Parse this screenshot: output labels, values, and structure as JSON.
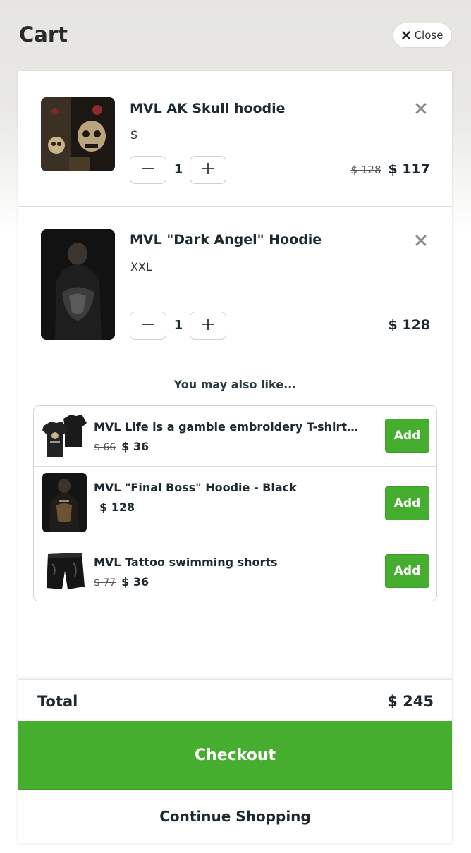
{
  "header": {
    "title": "Cart",
    "close_label": "Close",
    "close_icon": "close-icon"
  },
  "cart": {
    "items": [
      {
        "name": "MVL AK Skull hoodie",
        "variant": "S",
        "quantity": "1",
        "old_price": "$ 128",
        "price": "$ 117",
        "image_icon": "skull-hoodie-image"
      },
      {
        "name": "MVL \"Dark Angel\" Hoodie",
        "variant": "XXL",
        "quantity": "1",
        "old_price": "",
        "price": "$ 128",
        "image_icon": "dark-angel-hoodie-image"
      }
    ]
  },
  "upsell": {
    "title": "You may also like...",
    "add_label": "Add",
    "items": [
      {
        "name": "MVL Life is a gamble embroidery T-shirt - Black",
        "old_price": "$ 66",
        "price": "$ 36",
        "image_icon": "tshirt-image"
      },
      {
        "name": "MVL \"Final Boss\" Hoodie - Black",
        "old_price": "",
        "price": "$ 128",
        "image_icon": "final-boss-hoodie-image"
      },
      {
        "name": "MVL Tattoo swimming shorts",
        "old_price": "$ 77",
        "price": "$ 36",
        "image_icon": "swim-shorts-image"
      }
    ]
  },
  "footer": {
    "total_label": "Total",
    "total_value": "$ 245",
    "checkout_label": "Checkout",
    "continue_label": "Continue Shopping"
  },
  "colors": {
    "accent_green": "#46ae2e",
    "text_dark": "#1f2a30",
    "header_bg": "#e6e5e1"
  }
}
